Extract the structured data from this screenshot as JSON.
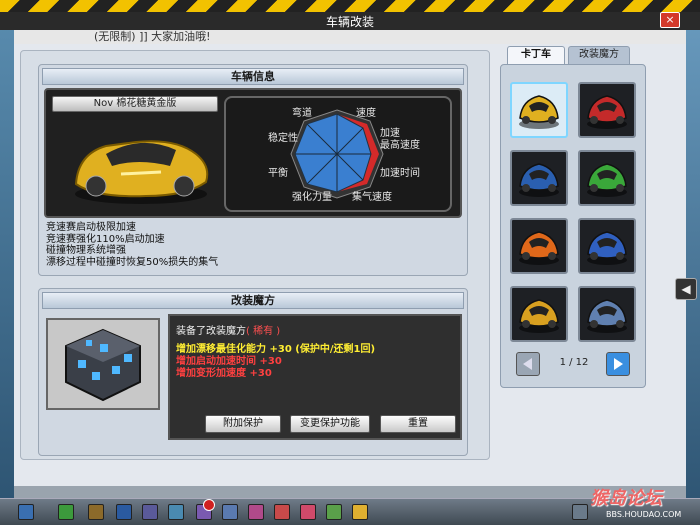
{
  "window": {
    "title": "车辆改装",
    "close_label": "×"
  },
  "marquee": {
    "text": "(无限制) ]] 大家加油哦!"
  },
  "vehicle_info": {
    "header": "车辆信息",
    "car_name": "Nov 棉花糖黄金版",
    "radar_labels": [
      "弯道",
      "速度",
      "稳定性",
      "加速",
      "最高速度",
      "平衡",
      "加速时间",
      "强化力量",
      "集气速度"
    ],
    "description": [
      "竞速赛启动极限加速",
      "竞速赛强化110%启动加速",
      "碰撞物理系统增强",
      "漂移过程中碰撞时恢复50%损失的集气"
    ]
  },
  "mod_magic": {
    "header": "改装魔方",
    "equipped_prefix": "装备了改装魔方",
    "equipped_name": "( 稀有 )",
    "effects": [
      {
        "text": "增加漂移最佳化能力 +30 (保护中/还剩1回)",
        "color": "#ffee33"
      },
      {
        "text": "增加启动加速时间 +30",
        "color": "#ff4040"
      },
      {
        "text": "增加变形加速度 +30",
        "color": "#ff4040"
      }
    ],
    "buttons": {
      "protect": "附加保护",
      "change_protect": "变更保护功能",
      "reset": "重置"
    }
  },
  "right_panel": {
    "tabs": [
      "卡丁车",
      "改装魔方"
    ],
    "slots": [
      {
        "color": "#e0b020",
        "name": "gold-kart"
      },
      {
        "color": "#c42a2a",
        "name": "red-kart"
      },
      {
        "color": "#2a5fb0",
        "name": "blue-kart"
      },
      {
        "color": "#3aa83a",
        "name": "green-kart"
      },
      {
        "color": "#e0681a",
        "name": "orange-kart"
      },
      {
        "color": "#3060c0",
        "name": "blue-kart-2"
      },
      {
        "color": "#d8a020",
        "name": "yellow-kart"
      },
      {
        "color": "#6080b0",
        "name": "character-kart"
      }
    ],
    "pager": {
      "label": "1 / 12"
    }
  },
  "watermark": {
    "text": "猴岛论坛",
    "sub": "BBS.HOUDAO.COM"
  }
}
